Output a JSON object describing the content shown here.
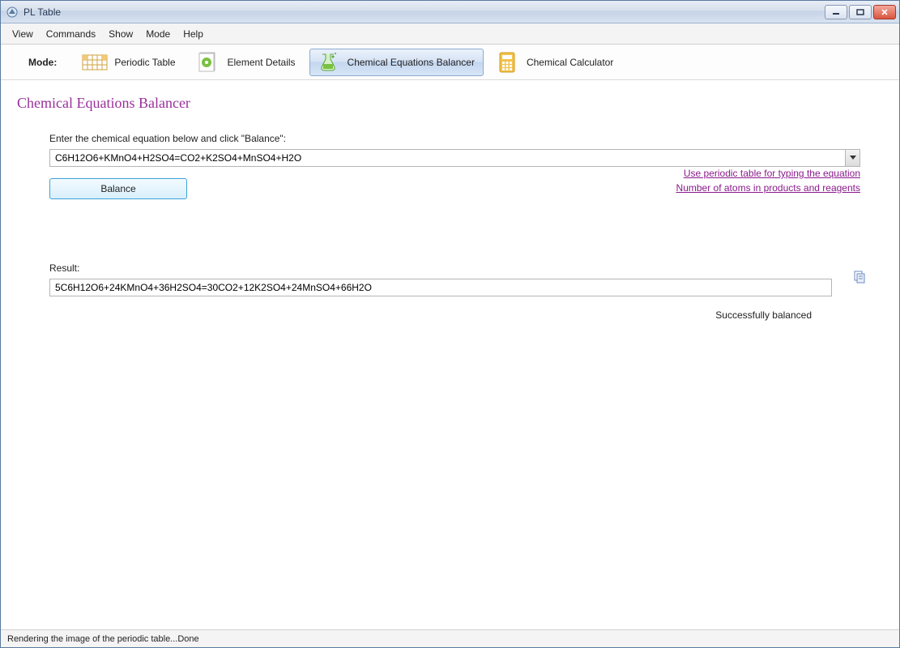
{
  "window": {
    "title": "PL Table"
  },
  "menu": {
    "items": [
      "View",
      "Commands",
      "Show",
      "Mode",
      "Help"
    ]
  },
  "toolbar": {
    "mode_label": "Mode:",
    "modes": [
      {
        "label": "Periodic Table"
      },
      {
        "label": "Element Details"
      },
      {
        "label": "Chemical Equations Balancer",
        "active": true
      },
      {
        "label": "Chemical Calculator"
      }
    ]
  },
  "page": {
    "title": "Chemical Equations Balancer",
    "input_label": "Enter the chemical equation below and click \"Balance\":",
    "equation_value": "C6H12O6+KMnO4+H2SO4=CO2+K2SO4+MnSO4+H2O",
    "balance_button": "Balance",
    "links": {
      "periodic": "Use periodic table for typing the equation",
      "atoms": "Number of atoms in products and reagents"
    },
    "result_label": "Result:",
    "result_value": "5C6H12O6+24KMnO4+36H2SO4=30CO2+12K2SO4+24MnSO4+66H2O",
    "status": "Successfully balanced"
  },
  "statusbar": {
    "text": "Rendering the image of the periodic table...Done"
  }
}
